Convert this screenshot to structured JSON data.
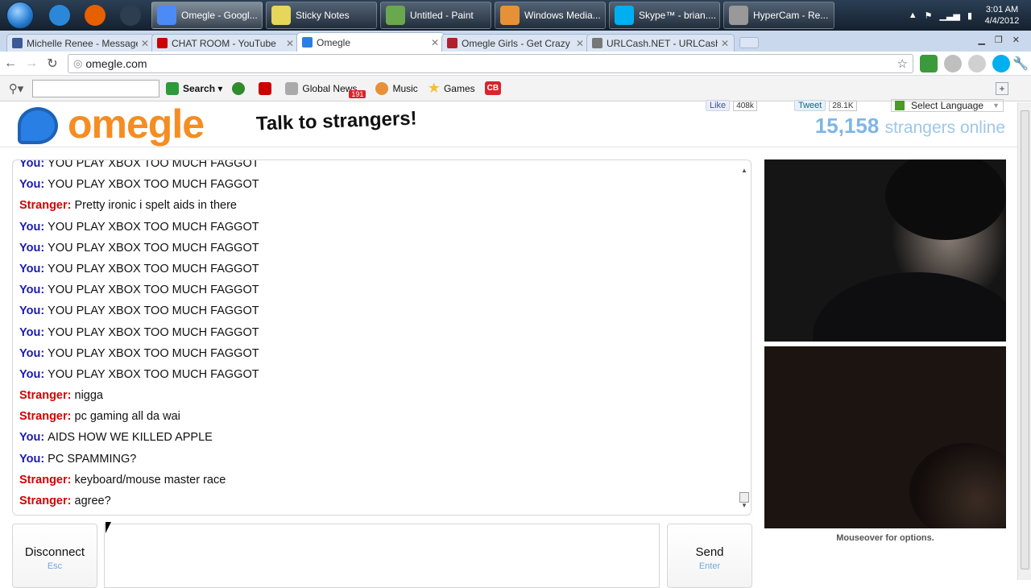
{
  "taskbar": {
    "pinned": [
      {
        "name": "ie-icon",
        "color": "#2b88d9"
      },
      {
        "name": "firefox-icon",
        "color": "#e66000"
      },
      {
        "name": "app-icon",
        "color": "#2c3e50"
      }
    ],
    "tasks": [
      {
        "label": "Omegle - Googl...",
        "icon": "chrome-icon",
        "color": "#4c8bf5",
        "active": true
      },
      {
        "label": "Sticky Notes",
        "icon": "sticky-notes-icon",
        "color": "#e6d65a",
        "active": false
      },
      {
        "label": "Untitled - Paint",
        "icon": "paint-icon",
        "color": "#6aa84f",
        "active": false
      },
      {
        "label": "Windows Media...",
        "icon": "media-player-icon",
        "color": "#e69138",
        "active": false
      },
      {
        "label": "Skype™ - brian....",
        "icon": "skype-icon",
        "color": "#00aff0",
        "active": false
      },
      {
        "label": "HyperCam - Re...",
        "icon": "hypercam-icon",
        "color": "#999999",
        "active": false
      }
    ],
    "clock_time": "3:01 AM",
    "clock_date": "4/4/2012"
  },
  "tabs": [
    {
      "label": "Michelle Renee - Messages",
      "color": "#3b5998",
      "active": false
    },
    {
      "label": "CHAT ROOM - YouTube",
      "color": "#cc0000",
      "active": false
    },
    {
      "label": "Omegle",
      "color": "#2a7fe4",
      "active": true
    },
    {
      "label": "Omegle Girls - Get Crazy wi",
      "color": "#b21f2d",
      "active": false
    },
    {
      "label": "URLCash.NET - URLCash.NI",
      "color": "#777777",
      "active": false
    }
  ],
  "address": {
    "url": "omegle.com"
  },
  "search_toolbar": {
    "search_label": "Search",
    "global_news": "Global News",
    "news_badge": "191",
    "music": "Music",
    "games": "Games",
    "cb": "CB"
  },
  "header": {
    "logo": "omegle",
    "tagline": "Talk to strangers!",
    "fb_like": "Like",
    "fb_count": "408k",
    "tweet": "Tweet",
    "tweet_count": "28.1K",
    "language": "Select Language",
    "online_count": "15,158",
    "online_text": "strangers online"
  },
  "chat": {
    "messages": [
      {
        "who": "You",
        "text": "YOU PLAY XBOX TOO MUCH FAGGOT"
      },
      {
        "who": "You",
        "text": "YOU PLAY XBOX TOO MUCH FAGGOT"
      },
      {
        "who": "Stranger",
        "text": "Pretty ironic i spelt aids in there"
      },
      {
        "who": "You",
        "text": "YOU PLAY XBOX TOO MUCH FAGGOT"
      },
      {
        "who": "You",
        "text": "YOU PLAY XBOX TOO MUCH FAGGOT"
      },
      {
        "who": "You",
        "text": "YOU PLAY XBOX TOO MUCH FAGGOT"
      },
      {
        "who": "You",
        "text": "YOU PLAY XBOX TOO MUCH FAGGOT"
      },
      {
        "who": "You",
        "text": "YOU PLAY XBOX TOO MUCH FAGGOT"
      },
      {
        "who": "You",
        "text": "YOU PLAY XBOX TOO MUCH FAGGOT"
      },
      {
        "who": "You",
        "text": "YOU PLAY XBOX TOO MUCH FAGGOT"
      },
      {
        "who": "You",
        "text": "YOU PLAY XBOX TOO MUCH FAGGOT"
      },
      {
        "who": "Stranger",
        "text": "nigga"
      },
      {
        "who": "Stranger",
        "text": "pc gaming all da wai"
      },
      {
        "who": "You",
        "text": "AIDS HOW WE KILLED APPLE"
      },
      {
        "who": "You",
        "text": "PC SPAMMING?"
      },
      {
        "who": "Stranger",
        "text": "keyboard/mouse master race"
      },
      {
        "who": "Stranger",
        "text": "agree?"
      }
    ]
  },
  "video": {
    "mouseover": "Mouseover for options."
  },
  "controls": {
    "disconnect": "Disconnect",
    "disconnect_key": "Esc",
    "send": "Send",
    "send_key": "Enter"
  }
}
